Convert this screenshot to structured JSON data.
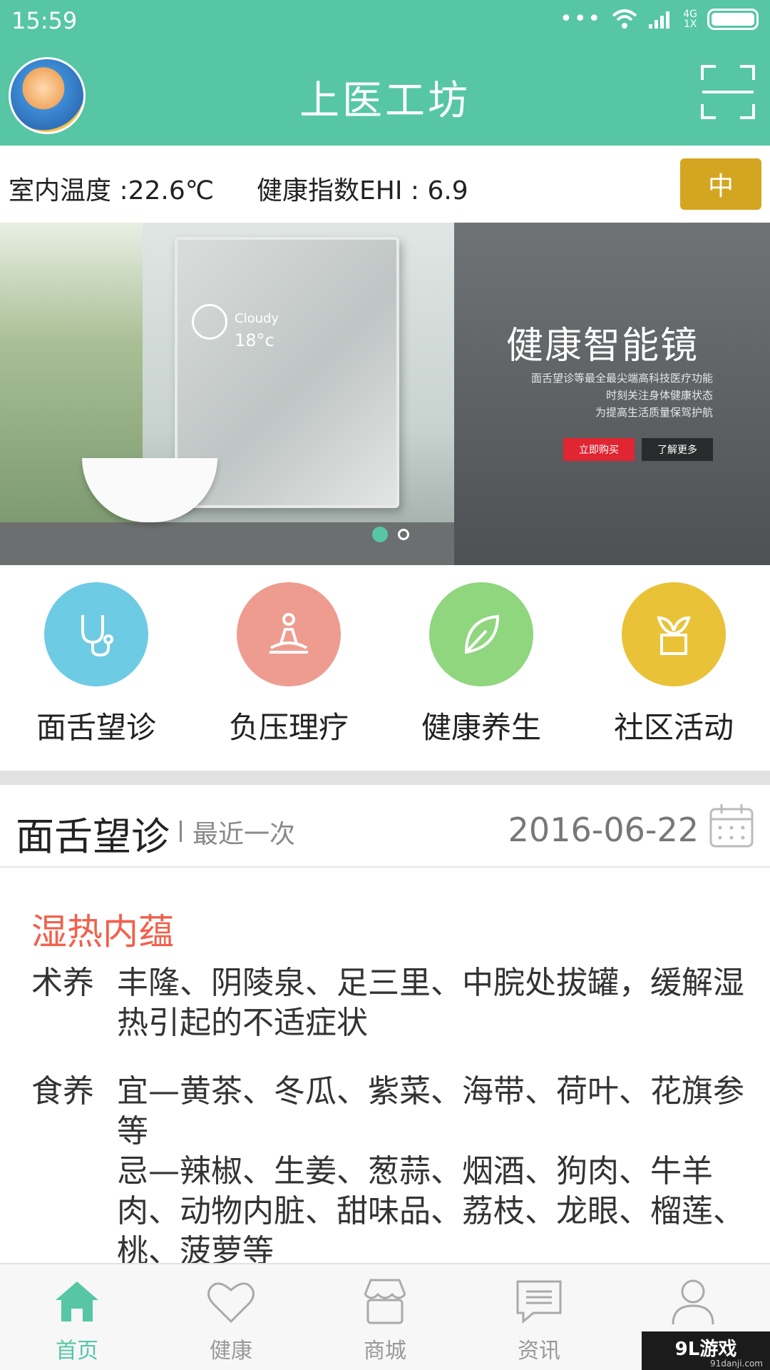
{
  "status_bar": {
    "time": "15:59",
    "network_top": "4G",
    "network_bottom": "1X",
    "dots": "•••"
  },
  "app_bar": {
    "title": "上医工坊"
  },
  "info_bar": {
    "temperature": "室内温度 :22.6℃",
    "ehi": "健康指数EHI : 6.9",
    "badge": "中"
  },
  "banner": {
    "weather_label": "Cloudy",
    "weather_temp": "18°c",
    "headline": "健康智能镜",
    "sub_lines": [
      "面舌望诊等最全最尖端高科技医疗功能",
      "时刻关注身体健康状态",
      "为提高生活质量保驾护航"
    ],
    "buy_label": "立即购买",
    "more_label": "了解更多",
    "active_slide": 1,
    "slide_count": 2
  },
  "features": [
    {
      "label": "面舌望诊",
      "icon": "stethoscope-icon",
      "color": "#6ecbe4"
    },
    {
      "label": "负压理疗",
      "icon": "meditation-icon",
      "color": "#ee9c90"
    },
    {
      "label": "健康养生",
      "icon": "leaf-icon",
      "color": "#8fd67e"
    },
    {
      "label": "社区活动",
      "icon": "plant-pot-icon",
      "color": "#e9c238"
    }
  ],
  "section": {
    "title": "面舌望诊",
    "subtitle": "最近一次",
    "date": "2016-06-22"
  },
  "result": {
    "diagnosis": "湿热内蕴",
    "therapy_label": "术养",
    "therapy_text": "丰隆、阴陵泉、足三里、中脘处拔罐，缓解湿热引起的不适症状",
    "diet_label": "食养",
    "diet_good": "宜—黄茶、冬瓜、紫菜、海带、荷叶、花旗参等",
    "diet_bad": "忌—辣椒、生姜、葱蒜、烟酒、狗肉、牛羊肉、动物内脏、甜味品、荔枝、龙眼、榴莲、桃、菠萝等"
  },
  "tabs": [
    {
      "label": "首页",
      "icon": "home-icon",
      "active": true
    },
    {
      "label": "健康",
      "icon": "heart-icon",
      "active": false
    },
    {
      "label": "商城",
      "icon": "shop-icon",
      "active": false
    },
    {
      "label": "资讯",
      "icon": "message-icon",
      "active": false
    },
    {
      "label": "",
      "icon": "user-icon",
      "active": false
    }
  ],
  "watermark": {
    "brand": "9L游戏",
    "url": "91danji.com"
  },
  "colors": {
    "primary": "#56c6a5",
    "badge": "#d4a520",
    "diagnosis": "#f2604b"
  }
}
